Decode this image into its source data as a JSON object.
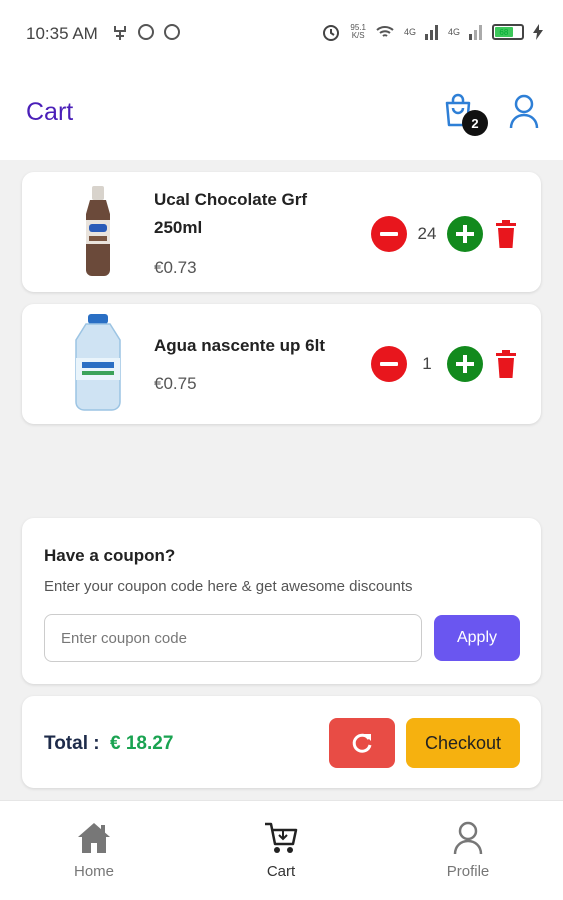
{
  "status_bar": {
    "time": "10:35 AM",
    "net_speed_value": "95.1",
    "net_speed_unit": "K/S",
    "signal_1": "4G",
    "signal_2": "4G",
    "battery": "68"
  },
  "header": {
    "title": "Cart",
    "cart_count": "2"
  },
  "cart": {
    "items": [
      {
        "name": "Ucal Chocolate Grf 250ml",
        "price": "€0.73",
        "quantity": "24",
        "image_icon": "chocolate-milk-bottle-icon"
      },
      {
        "name": "Agua nascente up 6lt",
        "price": "€0.75",
        "quantity": "1",
        "image_icon": "water-jug-icon"
      }
    ]
  },
  "coupon": {
    "title": "Have a coupon?",
    "subtitle": "Enter your coupon code here & get awesome discounts",
    "placeholder": "Enter coupon code",
    "apply_label": "Apply"
  },
  "summary": {
    "total_label": "Total :",
    "total_value": "€ 18.27",
    "checkout_label": "Checkout"
  },
  "bottom_nav": [
    {
      "label": "Home",
      "active": false
    },
    {
      "label": "Cart",
      "active": true
    },
    {
      "label": "Profile",
      "active": false
    }
  ],
  "colors": {
    "title": "#4a1fb8",
    "minus": "#e8161d",
    "plus": "#128a1d",
    "apply": "#6a56f0",
    "total_value": "#1aa351",
    "refresh": "#e84c45",
    "checkout": "#f6b10f"
  }
}
